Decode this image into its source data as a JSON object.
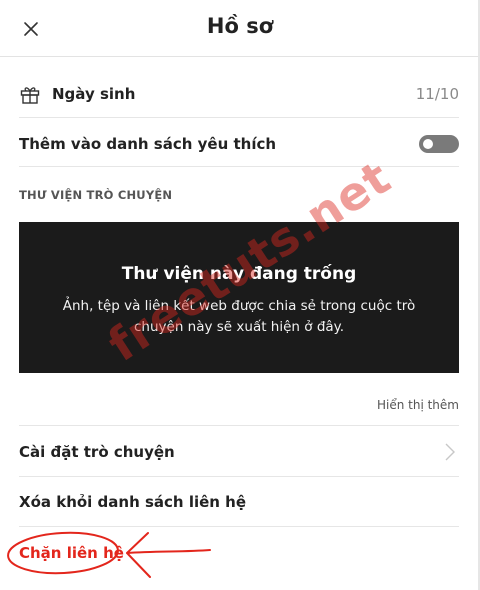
{
  "header": {
    "title": "Hồ sơ",
    "close_icon": "close-icon"
  },
  "birthday": {
    "icon": "gift-icon",
    "label": "Ngày sinh",
    "value": "11/10"
  },
  "favorites": {
    "label": "Thêm vào danh sách yêu thích",
    "toggle_on": false
  },
  "library": {
    "section_title": "THƯ VIỆN TRÒ CHUYỆN",
    "empty_title": "Thư viện này đang trống",
    "empty_desc": "Ảnh, tệp và liên kết web được chia sẻ trong cuộc trò chuyện này sẽ xuất hiện ở đây.",
    "show_more": "Hiển thị thêm"
  },
  "menu": {
    "settings_label": "Cài đặt trò chuyện",
    "remove_label": "Xóa khỏi danh sách liên hệ",
    "block_label": "Chặn liên hệ"
  },
  "watermark": "freetuts.net",
  "colors": {
    "accent_red": "#e3261c",
    "library_bg": "#1b1b1b",
    "toggle_off": "#7a7a7a"
  }
}
